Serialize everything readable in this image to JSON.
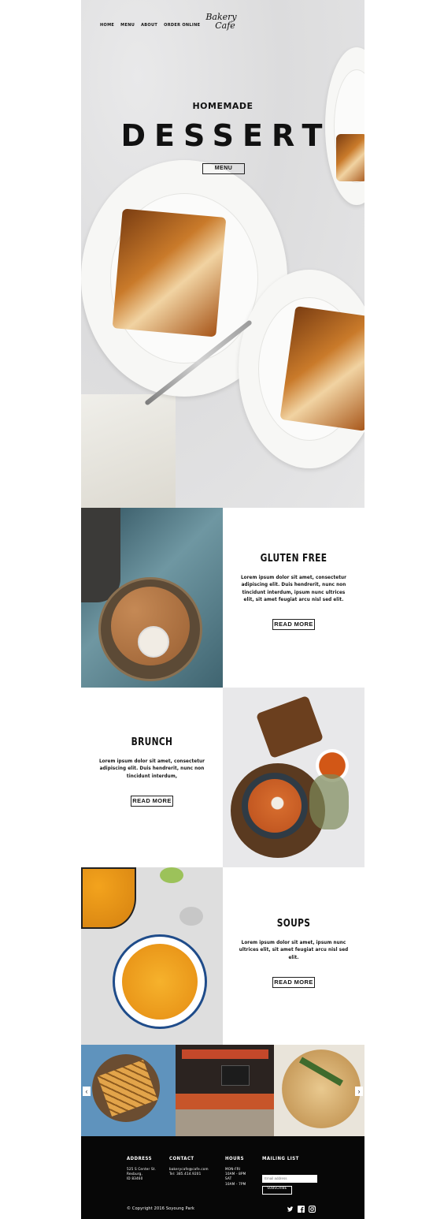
{
  "nav": {
    "items": [
      "HOME",
      "MENU",
      "ABOUT",
      "ORDER ONLINE"
    ]
  },
  "logo": {
    "line1": "Bakery",
    "line2": "Cafe"
  },
  "hero": {
    "subtitle": "HOMEMADE",
    "title": "DESSERT",
    "button": "MENU"
  },
  "sections": [
    {
      "title": "GLUTEN FREE",
      "text": "Lorem ipsum dolor sit amet, consectetur adipiscing elit. Duis hendrerit, nunc non tincidunt interdum, ipsum nunc ultrices elit, sit amet feugiat arcu nisl sed elit.",
      "button": "READ MORE"
    },
    {
      "title": "BRUNCH",
      "text": "Lorem ipsum dolor sit amet, consectetur adipiscing elit. Duis hendrerit, nunc non tincidunt interdum,",
      "button": "READ MORE"
    },
    {
      "title": "SOUPS",
      "text": "Lorem ipsum dolor sit amet, ipsum nunc ultrices elit, sit  amet feugiat arcu nisl sed elit.",
      "button": "READ MORE"
    }
  ],
  "gallery": {
    "prev": "‹",
    "next": "›"
  },
  "footer": {
    "address": {
      "heading": "ADDRESS",
      "lines": [
        "525 S Center St.",
        "Rexburg,",
        "ID 83460"
      ]
    },
    "contact": {
      "heading": "CONTACT",
      "lines": [
        "bakerycafe@cafe.com",
        "Tel: 385.414.9201"
      ]
    },
    "hours": {
      "heading": "HOURS",
      "lines": [
        "MON-FRI",
        "10AM - 8PM",
        "SAT",
        "10AM - 7PM"
      ]
    },
    "mailing": {
      "heading": "MAILING LIST",
      "placeholder": "Email address",
      "button": "SUBSCRIBE"
    },
    "copyright": "© Copyright 2016 Soyoung Park",
    "social": {
      "twitter": "twitter-icon",
      "facebook": "facebook-icon",
      "instagram": "instagram-icon"
    }
  }
}
